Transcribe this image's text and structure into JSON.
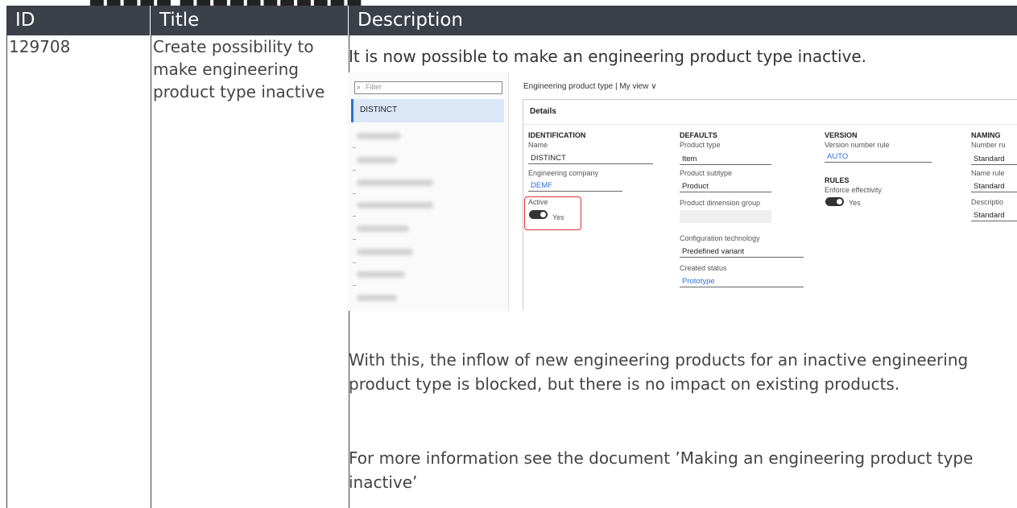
{
  "table": {
    "headers": [
      "ID",
      "Title",
      "Description"
    ],
    "row": {
      "id": "129708",
      "title": "Create possibility to make engineering product type inactive",
      "description_intro": "It is now possible to make an engineering product type inactive.",
      "description_p2": "With this, the inflow of new engineering products for an inactive engineering product type is blocked, but there is no impact on existing products.",
      "description_p3": "For more information see the document ’Making an engineering product type inactive’"
    }
  },
  "screenshot": {
    "filter_placeholder": "Filter",
    "list_selected": "DISTINCT",
    "header": "Engineering product type  |  My view ∨",
    "details_label": "Details",
    "identification": {
      "heading": "IDENTIFICATION",
      "name_label": "Name",
      "name_value": "DISTINCT",
      "company_label": "Engineering company",
      "company_value": "DEMF",
      "active_label": "Active",
      "active_value": "Yes"
    },
    "defaults": {
      "heading": "DEFAULTS",
      "product_type_label": "Product type",
      "product_type_value": "Item",
      "product_subtype_label": "Product subtype",
      "product_subtype_value": "Product",
      "dimension_group_label": "Product dimension group",
      "config_tech_label": "Configuration technology",
      "config_tech_value": "Predefined variant",
      "created_status_label": "Created status",
      "created_status_value": "Prototype"
    },
    "version": {
      "heading": "VERSION",
      "rule_label": "Version number rule",
      "rule_value": "AUTO",
      "rules_heading": "RULES",
      "enforce_label": "Enforce effectivity",
      "enforce_value": "Yes"
    },
    "naming": {
      "heading": "NAMING",
      "number_label": "Number ru",
      "number_value": "Standard",
      "name_rule_label": "Name rule",
      "name_rule_value": "Standard",
      "description_label": "Descriptio",
      "description_value": "Standard"
    }
  },
  "colors": {
    "header_bg": "#3b4049",
    "accent": "#2f6fd6",
    "highlight": "#e03030"
  }
}
